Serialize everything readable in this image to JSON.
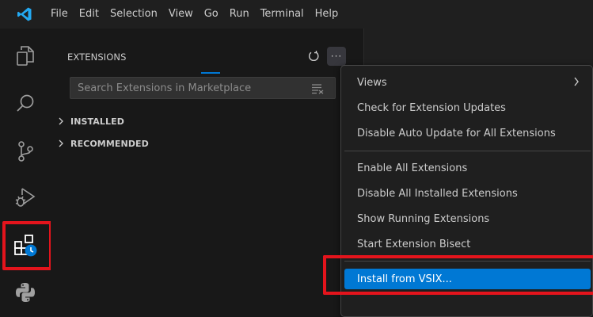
{
  "menubar": {
    "items": [
      "File",
      "Edit",
      "Selection",
      "View",
      "Go",
      "Run",
      "Terminal",
      "Help"
    ]
  },
  "activity_bar": {
    "icons": [
      "explorer-icon",
      "search-icon",
      "source-control-icon",
      "run-debug-icon",
      "extensions-icon",
      "python-icon"
    ],
    "highlighted": "extensions-icon",
    "highlight_color": "#e4141c"
  },
  "sidebar": {
    "title": "EXTENSIONS",
    "search": {
      "placeholder": "Search Extensions in Marketplace",
      "value": ""
    },
    "sections": [
      {
        "label": "INSTALLED",
        "expanded": false
      },
      {
        "label": "RECOMMENDED",
        "expanded": false
      }
    ],
    "actions": {
      "more_label": "···"
    }
  },
  "context_menu": {
    "items": [
      {
        "label": "Views",
        "has_submenu": true
      },
      {
        "label": "Check for Extension Updates"
      },
      {
        "label": "Disable Auto Update for All Extensions"
      },
      {
        "label": "Enable All Extensions"
      },
      {
        "label": "Disable All Installed Extensions"
      },
      {
        "label": "Show Running Extensions"
      },
      {
        "label": "Start Extension Bisect"
      },
      {
        "label": "Install from VSIX...",
        "selected": true
      }
    ],
    "selected_color": "#0078d4"
  },
  "colors": {
    "accent": "#0078d4",
    "annotation_red": "#e4141c",
    "logo_blue": "#23a9f2"
  }
}
